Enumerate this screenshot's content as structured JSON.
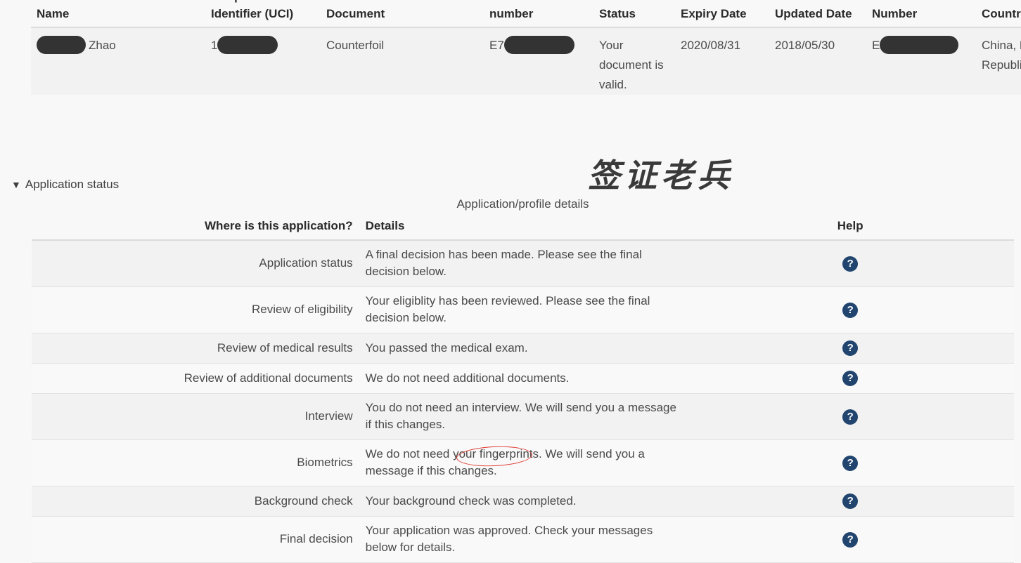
{
  "document_table": {
    "headers": [
      "Name",
      "Unique Client Identifier (UCI)",
      "Document",
      "Document number",
      "Status",
      "Expiry Date",
      "Status Updated Date",
      "Travel document Number",
      "Country of Issue"
    ],
    "row": {
      "name_prefix": "",
      "name_suffix": "Zhao",
      "uci_prefix": "1",
      "uci_suffix": "",
      "document": "Counterfoil",
      "docnum_prefix": "E7",
      "docnum_suffix": "",
      "status": "Your document is valid.",
      "expiry_date": "2020/08/31",
      "status_updated_date": "2018/05/30",
      "travel_docnum_prefix": "E",
      "travel_docnum_suffix": "",
      "country_of_issue": "China, People's Republic of"
    }
  },
  "application_status_section": {
    "toggle_arrow": "▼",
    "toggle_label": "Application status",
    "caption": "Application/profile details"
  },
  "watermark": {
    "text": "签证老兵"
  },
  "status_table": {
    "headers": {
      "where": "Where is this application?",
      "details": "Details",
      "help": "Help"
    },
    "help_icon_glyph": "?",
    "rows": [
      {
        "where": "Application status",
        "details": "A final decision has been made. Please see the final decision below."
      },
      {
        "where": "Review of eligibility",
        "details": "Your eligiblity has been reviewed. Please see the final decision below."
      },
      {
        "where": "Review of medical results",
        "details": "You passed the medical exam."
      },
      {
        "where": "Review of additional documents",
        "details": "We do not need additional documents."
      },
      {
        "where": "Interview",
        "details": "You do not need an interview. We will send you a message if this changes."
      },
      {
        "where": "Biometrics",
        "details": "We do not need your fingerprints. We will send you a message if this changes."
      },
      {
        "where": "Background check",
        "details": "Your background check was completed."
      },
      {
        "where": "Final decision",
        "details": "Your application was approved. Check your messages below for details."
      }
    ]
  },
  "annotations": {
    "ellipse_color": "#e03a30",
    "ellipse_target_word": "approved"
  },
  "colors": {
    "help_icon_background": "#21456e",
    "row_odd": "#f2f2f2",
    "row_even": "#f9f9f9",
    "page_background": "#f8f8f8",
    "redaction": "#333333"
  }
}
